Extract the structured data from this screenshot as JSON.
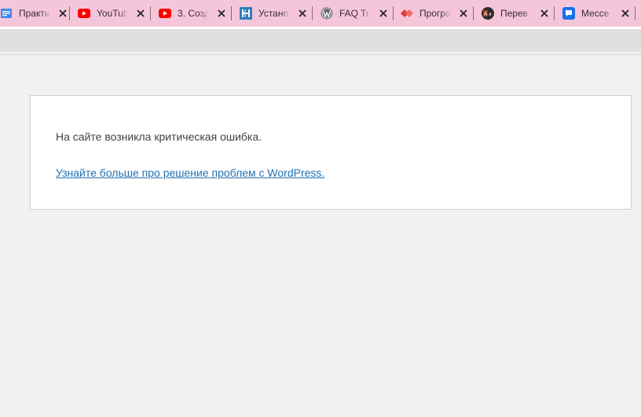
{
  "tabs": [
    {
      "title": "Практи",
      "icon": "docs-icon",
      "color": "#4285f4"
    },
    {
      "title": "YouTub",
      "icon": "youtube-icon",
      "color": "#ff0000"
    },
    {
      "title": "3. Созд",
      "icon": "youtube-icon",
      "color": "#ff0000"
    },
    {
      "title": "Устано",
      "icon": "h-logo-icon",
      "color": "#2c7fb8"
    },
    {
      "title": "FAQ Tro",
      "icon": "wordpress-icon",
      "color": "#5f6368"
    },
    {
      "title": "Програ",
      "icon": "diamond-icon",
      "color": "#e53935"
    },
    {
      "title": "Перев",
      "icon": "translate-icon",
      "color": "#b23a1f"
    },
    {
      "title": "Мессе",
      "icon": "messenger-icon",
      "color": "#1a73e8"
    }
  ],
  "error": {
    "message": "На сайте возникла критическая ошибка.",
    "link_text": "Узнайте больше про решение проблем с WordPress."
  },
  "colors": {
    "tabbar_bg": "#f5c6da",
    "page_bg": "#f1f1f1",
    "link": "#2271b1",
    "text": "#3c434a"
  }
}
